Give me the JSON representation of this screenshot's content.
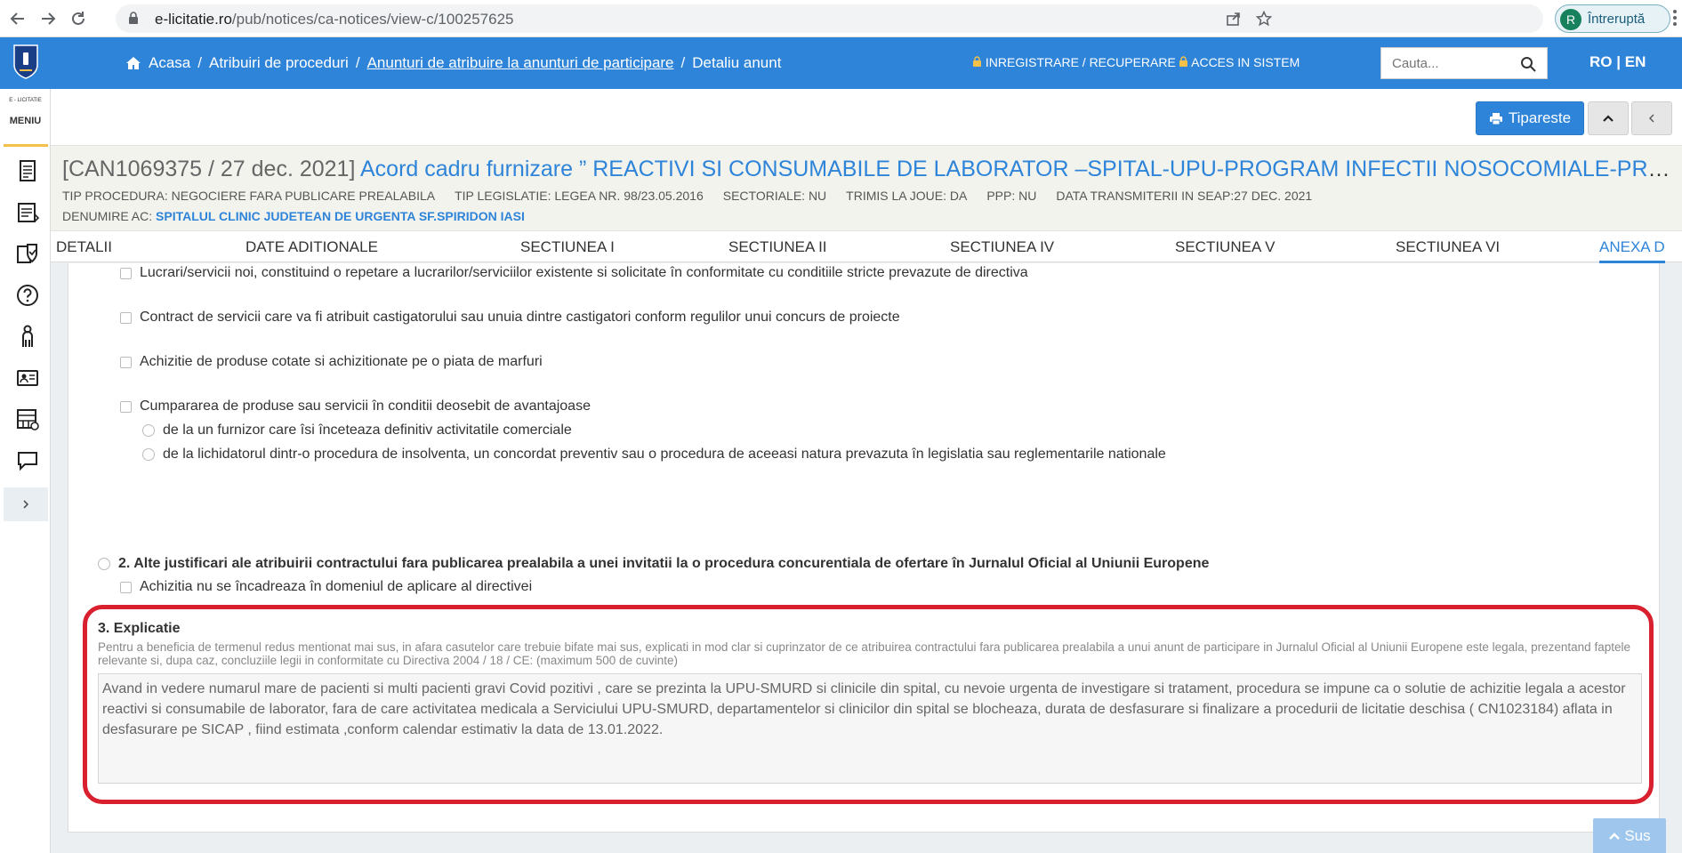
{
  "browser": {
    "url_host": "e-licitatie.ro",
    "url_path": "/pub/notices/ca-notices/view-c/100257625",
    "profile_initial": "R",
    "profile_status": "Întreruptă"
  },
  "topnav": {
    "breadcrumb": [
      "Acasa",
      "Atribuiri de proceduri",
      "Anunturi de atribuire la anunturi de participare",
      "Detaliu anunt"
    ],
    "register": "INREGISTRARE / RECUPERARE",
    "login": "ACCES IN SISTEM",
    "search_placeholder": "Cauta...",
    "lang_ro": "RO",
    "lang_sep": "|",
    "lang_en": "EN"
  },
  "sidebar": {
    "brand": "E - LICITATIE",
    "menu_label": "MENIU",
    "icons": [
      "document-icon",
      "list-icon",
      "shield-check-icon",
      "help-icon",
      "person-icon",
      "id-card-icon",
      "catalog-icon",
      "chat-icon"
    ]
  },
  "actions": {
    "print_label": "Tipareste"
  },
  "notice": {
    "code": "[CAN1069375 / 27 dec. 2021]",
    "title": "Acord cadru furnizare ” REACTIVI SI CONSUMABILE DE LABORATOR –SPITAL-UPU-PROGRAM INFECTII NOSOCOMIALE-PROGRAM AP-ATI”",
    "meta": [
      "TIP PROCEDURA: NEGOCIERE FARA PUBLICARE PREALABILA",
      "TIP LEGISLATIE: LEGEA NR. 98/23.05.2016",
      "SECTORIALE: NU",
      "TRIMIS LA JOUE: DA",
      "PPP: NU",
      "DATA TRANSMITERII IN SEAP:27 DEC. 2021"
    ],
    "ac_label": "DENUMIRE AC:",
    "ac_value": "SPITALUL CLINIC JUDETEAN DE URGENTA SF.SPIRIDON IASI"
  },
  "tabs": [
    "DETALII",
    "DATE ADITIONALE",
    "SECTIUNEA I",
    "SECTIUNEA II",
    "SECTIUNEA IV",
    "SECTIUNEA V",
    "SECTIUNEA VI",
    "ANEXA D"
  ],
  "active_tab": "ANEXA D",
  "content": {
    "opt1": "Lucrari/servicii noi, constituind o repetare a lucrarilor/serviciilor existente si solicitate în conformitate cu conditiile stricte prevazute de directiva",
    "opt2": "Contract de servicii care va fi atribuit castigatorului sau unuia dintre castigatori conform regulilor unui concurs de proiecte",
    "opt3": "Achizitie de produse cotate si achizitionate pe o piata de marfuri",
    "opt4": "Cumpararea de produse sau servicii în conditii deosebit de avantajoase",
    "opt4a": "de la un furnizor care îsi înceteaza definitiv activitatile comerciale",
    "opt4b": "de la lichidatorul dintr-o procedura de insolventa, un concordat preventiv sau o procedura de aceeasi natura prevazuta în legislatia sau reglementarile nationale",
    "section2": "2. Alte justificari ale atribuirii contractului fara publicarea prealabila a unei invitatii la o procedura concurentiala de ofertare în Jurnalul Oficial al Uniunii Europene",
    "section2_opt": "Achizitia nu se încadreaza în domeniul de aplicare al directivei",
    "section3_title": "3. Explicatie",
    "section3_help": "Pentru a beneficia de termenul redus mentionat mai sus, in afara casutelor care trebuie bifate mai sus, explicati in mod clar si cuprinzator de ce atribuirea contractului fara publicarea prealabila a unui anunt de participare in Jurnalul Oficial al Uniunii Europene este legala, prezentand faptele relevante si, dupa caz, concluziile legii in conformitate cu Directiva 2004 / 18 / CE: (maximum 500 de cuvinte)",
    "section3_text": "Avand in vedere numarul mare de pacienti si multi pacienti  gravi Covid pozitivi , care se prezinta la UPU-SMURD si clinicile din spital, cu nevoie urgenta de investigare  si tratament,  procedura se impune ca o solutie de achizitie legala a acestor reactivi si consumabile de laborator, fara de care activitatea medicala a Serviciului UPU-SMURD,  departamentelor si clinicilor din spital  se blocheaza, durata de desfasurare si finalizare a procedurii de licitatie deschisa ( CN1023184) aflata in  desfasurare pe SICAP  , fiind estimata ,conform calendar estimativ la data de  13.01.2022."
  },
  "back_to_top": "Sus",
  "colors": {
    "brand_blue": "#2e84d9",
    "highlight_red": "#d8202e"
  }
}
